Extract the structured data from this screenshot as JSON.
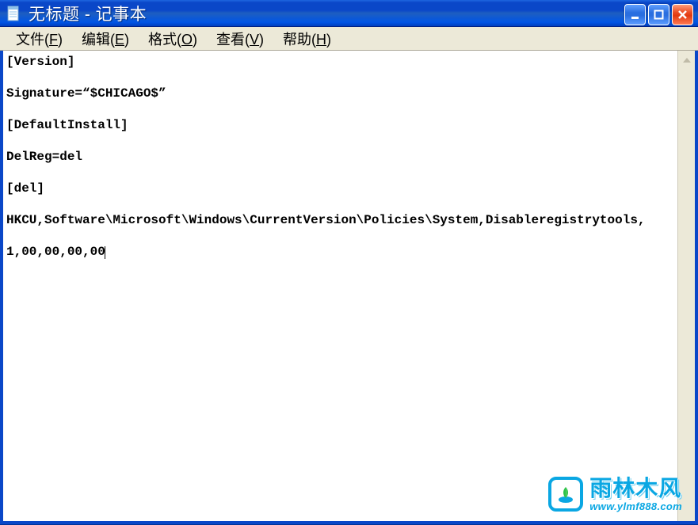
{
  "window": {
    "title": "无标题 - 记事本"
  },
  "menu": {
    "file": {
      "label": "文件",
      "accelerator": "F"
    },
    "edit": {
      "label": "编辑",
      "accelerator": "E"
    },
    "format": {
      "label": "格式",
      "accelerator": "O"
    },
    "view": {
      "label": "查看",
      "accelerator": "V"
    },
    "help": {
      "label": "帮助",
      "accelerator": "H"
    }
  },
  "editor": {
    "content": "[Version]\n\nSignature=“$CHICAGO$”\n\n[DefaultInstall]\n\nDelReg=del\n\n[del]\n\nHKCU,Software\\Microsoft\\Windows\\CurrentVersion\\Policies\\System,Disableregistrytools,\n\n1,00,00,00,00"
  },
  "watermark": {
    "brand": "雨林木风",
    "url": "www.ylmf888.com"
  }
}
